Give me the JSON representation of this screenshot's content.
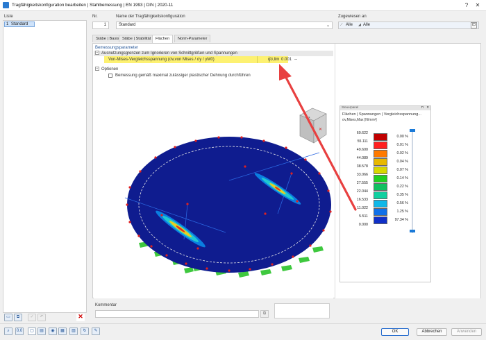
{
  "window": {
    "title": "Tragfähigkeitskonfiguration bearbeiten | Stahlbemessung | EN 1993 | DIN | 2020-11"
  },
  "list": {
    "header": "Liste",
    "items": [
      {
        "no": "1",
        "label": "Standard"
      }
    ]
  },
  "config": {
    "nr_label": "Nr.",
    "nr_value": "1",
    "name_label": "Name der Tragfähigkeitskonfiguration",
    "name_value": "Standard",
    "assigned_label": "Zugewiesen an",
    "assigned_value1": "Alle",
    "assigned_value2": "Alle"
  },
  "tabs": [
    "Stäbe | Basis",
    "Stäbe | Stabilität",
    "Flächen",
    "Norm-Parameter"
  ],
  "active_tab": "Flächen",
  "params": {
    "section_title": "Bemessungsparameter",
    "group1": "Ausnutzungsgrenzen zum Ignorieren von Schnittgrößen und Spannungen",
    "row_label": "Von-Mises-Vergleichsspannung (σv,von Mises / σy / γM0)",
    "row_symbol": "η̄σ,lim",
    "row_value": "0.001",
    "row_unit": "--",
    "group2": "Optionen",
    "checkbox_label": "Bemessung gemäß maximal zulässiger plastischer Dehnung durchführen",
    "checkbox_checked": false
  },
  "comment": {
    "label": "Kommentar",
    "value": ""
  },
  "legend": {
    "panel_title": "Steuerpanel",
    "title": "Flächen | Spannungen | Vergleichsspannung...",
    "subtitle": "σv,Mises,Max [N/mm²]",
    "rows": [
      {
        "value": "60.622",
        "color": "#c00000",
        "percent": "0.00 %"
      },
      {
        "value": "55.111",
        "color": "#ff2020",
        "percent": "0.01 %"
      },
      {
        "value": "49.600",
        "color": "#ff7a00",
        "percent": "0.02 %"
      },
      {
        "value": "44.089",
        "color": "#e8b800",
        "percent": "0.04 %"
      },
      {
        "value": "38.578",
        "color": "#d8d800",
        "percent": "0.07 %"
      },
      {
        "value": "33.066",
        "color": "#20d020",
        "percent": "0.14 %"
      },
      {
        "value": "27.555",
        "color": "#10c060",
        "percent": "0.22 %"
      },
      {
        "value": "22.044",
        "color": "#10d0a0",
        "percent": "0.35 %"
      },
      {
        "value": "16.533",
        "color": "#10b8e8",
        "percent": "0.56 %"
      },
      {
        "value": "11.022",
        "color": "#1070e8",
        "percent": "1.25 %"
      },
      {
        "value": "5.511",
        "color": "#1030c8",
        "percent": "97.34 %"
      },
      {
        "value": "0.000",
        "color": "#0a1a8a",
        "percent": ""
      }
    ]
  },
  "buttons": {
    "ok": "OK",
    "cancel": "Abbrechen",
    "apply": "Anwenden"
  }
}
